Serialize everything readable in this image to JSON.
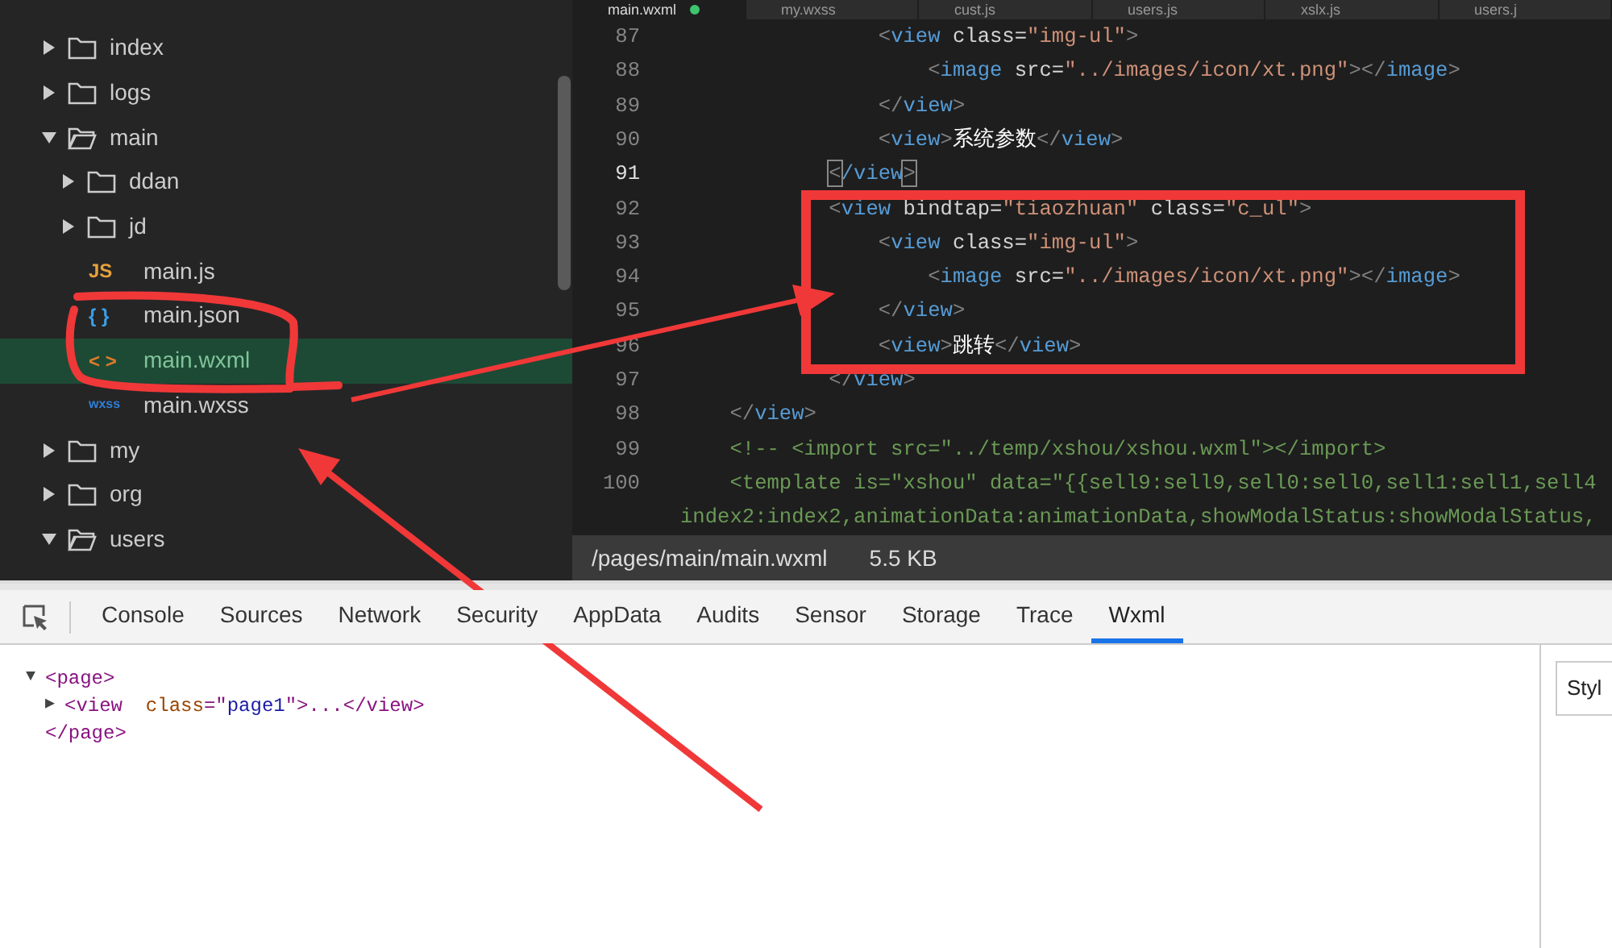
{
  "file_tree": [
    {
      "name": "index",
      "kind": "folder",
      "expanded": false,
      "selected": false
    },
    {
      "name": "logs",
      "kind": "folder",
      "expanded": false,
      "selected": false
    },
    {
      "name": "main",
      "kind": "folder",
      "expanded": true,
      "selected": false,
      "children": [
        {
          "name": "ddan",
          "kind": "folder",
          "expanded": false,
          "selected": false
        },
        {
          "name": "jd",
          "kind": "folder",
          "expanded": false,
          "selected": false
        },
        {
          "name": "main.js",
          "kind": "js",
          "icon_text": "JS",
          "selected": false
        },
        {
          "name": "main.json",
          "kind": "json",
          "icon_text": "{ }",
          "selected": false
        },
        {
          "name": "main.wxml",
          "kind": "wxml",
          "icon_text": "< >",
          "selected": true
        },
        {
          "name": "main.wxss",
          "kind": "wxss",
          "icon_text": "wxss",
          "selected": false
        }
      ]
    },
    {
      "name": "my",
      "kind": "folder",
      "expanded": false,
      "selected": false
    },
    {
      "name": "org",
      "kind": "folder",
      "expanded": false,
      "selected": false
    },
    {
      "name": "users",
      "kind": "folder",
      "expanded": true,
      "selected": false
    }
  ],
  "editor_tabs": [
    {
      "label": "main.wxml",
      "selected": true,
      "modified": true
    },
    {
      "label": "my.wxss",
      "selected": false,
      "modified": false
    },
    {
      "label": "cust.js",
      "selected": false,
      "modified": false
    },
    {
      "label": "users.js",
      "selected": false,
      "modified": false
    },
    {
      "label": "xslx.js",
      "selected": false,
      "modified": false
    },
    {
      "label": "users.j",
      "selected": false,
      "modified": false
    }
  ],
  "code_lines": [
    {
      "number": "87",
      "current": false,
      "segments": [
        {
          "kind": "punct",
          "t": "                <"
        },
        {
          "kind": "tag",
          "t": "view"
        },
        {
          "kind": "attr",
          "t": " class="
        },
        {
          "kind": "string",
          "t": "\"img-ul\""
        },
        {
          "kind": "punct",
          "t": ">"
        }
      ]
    },
    {
      "number": "88",
      "current": false,
      "segments": [
        {
          "kind": "punct",
          "t": "                    <"
        },
        {
          "kind": "tag",
          "t": "image"
        },
        {
          "kind": "attr",
          "t": " src="
        },
        {
          "kind": "string",
          "t": "\"../images/icon/xt.png\""
        },
        {
          "kind": "punct",
          "t": "></"
        },
        {
          "kind": "tag",
          "t": "image"
        },
        {
          "kind": "punct",
          "t": ">"
        }
      ]
    },
    {
      "number": "89",
      "current": false,
      "segments": [
        {
          "kind": "punct",
          "t": "                </"
        },
        {
          "kind": "tag",
          "t": "view"
        },
        {
          "kind": "punct",
          "t": ">"
        }
      ]
    },
    {
      "number": "90",
      "current": false,
      "segments": [
        {
          "kind": "punct",
          "t": "                <"
        },
        {
          "kind": "tag",
          "t": "view"
        },
        {
          "kind": "punct",
          "t": ">"
        },
        {
          "kind": "text",
          "t": "系统参数"
        },
        {
          "kind": "punct",
          "t": "</"
        },
        {
          "kind": "tag",
          "t": "view"
        },
        {
          "kind": "punct",
          "t": ">"
        }
      ]
    },
    {
      "number": "91",
      "current": true,
      "segments": [
        {
          "kind": "match",
          "t": "            <"
        },
        {
          "kind": "tag",
          "t": "/view"
        },
        {
          "kind": "match",
          "t": ">"
        }
      ]
    },
    {
      "number": "92",
      "current": false,
      "segments": [
        {
          "kind": "punct",
          "t": "            <"
        },
        {
          "kind": "tag",
          "t": "view"
        },
        {
          "kind": "attr",
          "t": " bindtap="
        },
        {
          "kind": "string",
          "t": "\"tiaozhuan\""
        },
        {
          "kind": "attr",
          "t": " class="
        },
        {
          "kind": "string",
          "t": "\"c_ul\""
        },
        {
          "kind": "punct",
          "t": ">"
        }
      ]
    },
    {
      "number": "93",
      "current": false,
      "segments": [
        {
          "kind": "punct",
          "t": "                <"
        },
        {
          "kind": "tag",
          "t": "view"
        },
        {
          "kind": "attr",
          "t": " class="
        },
        {
          "kind": "string",
          "t": "\"img-ul\""
        },
        {
          "kind": "punct",
          "t": ">"
        }
      ]
    },
    {
      "number": "94",
      "current": false,
      "segments": [
        {
          "kind": "punct",
          "t": "                    <"
        },
        {
          "kind": "tag",
          "t": "image"
        },
        {
          "kind": "attr",
          "t": " src="
        },
        {
          "kind": "string",
          "t": "\"../images/icon/xt.png\""
        },
        {
          "kind": "punct",
          "t": "></"
        },
        {
          "kind": "tag",
          "t": "image"
        },
        {
          "kind": "punct",
          "t": ">"
        }
      ]
    },
    {
      "number": "95",
      "current": false,
      "segments": [
        {
          "kind": "punct",
          "t": "                </"
        },
        {
          "kind": "tag",
          "t": "view"
        },
        {
          "kind": "punct",
          "t": ">"
        }
      ]
    },
    {
      "number": "96",
      "current": false,
      "segments": [
        {
          "kind": "punct",
          "t": "                <"
        },
        {
          "kind": "tag",
          "t": "view"
        },
        {
          "kind": "punct",
          "t": ">"
        },
        {
          "kind": "text",
          "t": "跳转"
        },
        {
          "kind": "punct",
          "t": "</"
        },
        {
          "kind": "tag",
          "t": "view"
        },
        {
          "kind": "punct",
          "t": ">"
        }
      ]
    },
    {
      "number": "97",
      "current": false,
      "segments": [
        {
          "kind": "punct",
          "t": "            </"
        },
        {
          "kind": "tag",
          "t": "view"
        },
        {
          "kind": "punct",
          "t": ">"
        }
      ]
    },
    {
      "number": "98",
      "current": false,
      "segments": [
        {
          "kind": "punct",
          "t": "    </"
        },
        {
          "kind": "tag",
          "t": "view"
        },
        {
          "kind": "punct",
          "t": ">"
        }
      ]
    },
    {
      "number": "99",
      "current": false,
      "segments": [
        {
          "kind": "comment",
          "t": "    <!-- <import src=\"../temp/xshou/xshou.wxml\"></import>"
        }
      ]
    },
    {
      "number": "100",
      "current": false,
      "segments": [
        {
          "kind": "comment",
          "t": "    <template is=\"xshou\" data=\"{{sell9:sell9,sell0:sell0,sell1:sell1,sell4"
        }
      ],
      "wrap": [
        {
          "kind": "comment",
          "t": "index2:index2,animationData:animationData,showModalStatus:showModalStatus,"
        }
      ]
    }
  ],
  "status_bar": {
    "path": "/pages/main/main.wxml",
    "size": "5.5 KB"
  },
  "devtools_tabs": [
    {
      "label": "Console",
      "selected": false
    },
    {
      "label": "Sources",
      "selected": false
    },
    {
      "label": "Network",
      "selected": false
    },
    {
      "label": "Security",
      "selected": false
    },
    {
      "label": "AppData",
      "selected": false
    },
    {
      "label": "Audits",
      "selected": false
    },
    {
      "label": "Sensor",
      "selected": false
    },
    {
      "label": "Storage",
      "selected": false
    },
    {
      "label": "Trace",
      "selected": false
    },
    {
      "label": "Wxml",
      "selected": true
    }
  ],
  "wxml_tree": [
    {
      "toggle": "▼",
      "segments": [
        {
          "kind": "tag",
          "t": "<page>"
        }
      ]
    },
    {
      "toggle": "▶",
      "segments": [
        {
          "kind": "tag",
          "t": "<view"
        },
        {
          "kind": "attr",
          "t": "  class"
        },
        {
          "kind": "punct",
          "t": "=\""
        },
        {
          "kind": "string",
          "t": "page1"
        },
        {
          "kind": "punct",
          "t": "\">...</view>"
        }
      ]
    },
    {
      "segments": [
        {
          "kind": "tag",
          "t": "</page>"
        }
      ]
    }
  ],
  "side_panel": {
    "tab": "Styl"
  }
}
